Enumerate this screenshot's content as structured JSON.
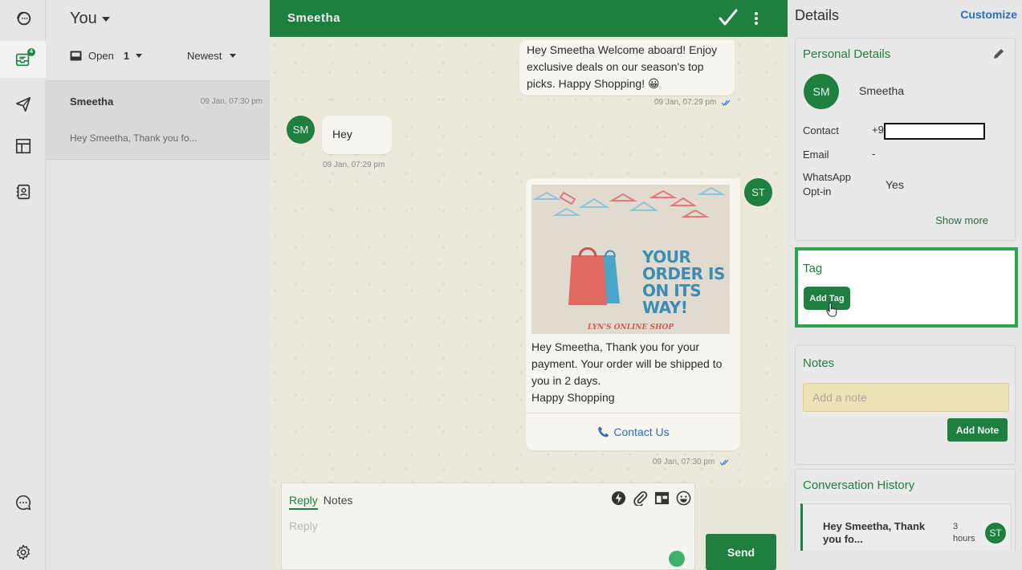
{
  "list": {
    "owner": "You",
    "status_filter": "Open",
    "open_count": "1",
    "sort": "Newest",
    "conversations": [
      {
        "name": "Smeetha",
        "time": "09 Jan, 07:30 pm",
        "preview": "Hey Smeetha, Thank you fo..."
      }
    ]
  },
  "rail": {
    "badge": "4"
  },
  "chat": {
    "title": "Smeetha",
    "messages": [
      {
        "text": "Hey Smeetha Welcome aboard! Enjoy exclusive deals on our season's top picks. Happy Shopping! 😀",
        "time": "09 Jan, 07:29 pm"
      },
      {
        "avatar": "SM",
        "text": "Hey",
        "time": "09 Jan, 07:29 pm"
      },
      {
        "avatar": "ST",
        "image_heading": "YOUR ORDER IS ON ITS WAY!",
        "image_shop": "LYN'S ONLINE SHOP",
        "text": "Hey Smeetha, Thank you for your payment. Your order will be shipped to you in 2 days.\nHappy Shopping",
        "cta": "Contact Us",
        "time": "09 Jan, 07:30 pm"
      }
    ],
    "composer": {
      "tab_reply": "Reply",
      "tab_notes": "Notes",
      "placeholder": "Reply",
      "send": "Send"
    }
  },
  "details": {
    "title": "Details",
    "customize": "Customize",
    "personal": {
      "title": "Personal Details",
      "avatar": "SM",
      "name": "Smeetha",
      "contact_label": "Contact",
      "contact_value": "+9",
      "email_label": "Email",
      "email_value": "-",
      "optin_label": "WhatsApp Opt-in",
      "optin_value": "Yes",
      "show_more": "Show more"
    },
    "tag": {
      "title": "Tag",
      "button": "Add Tag"
    },
    "notes": {
      "title": "Notes",
      "placeholder": "Add a note",
      "button": "Add Note"
    },
    "history": {
      "title": "Conversation History",
      "items": [
        {
          "text": "Hey Smeetha, Thank you fo...",
          "time": "3 hours",
          "avatar": "ST"
        }
      ]
    }
  },
  "colors": {
    "brand": "#1e7f40",
    "link": "#2f6fb5",
    "highlight": "#2aa552",
    "note_bg": "#ece3b4"
  }
}
